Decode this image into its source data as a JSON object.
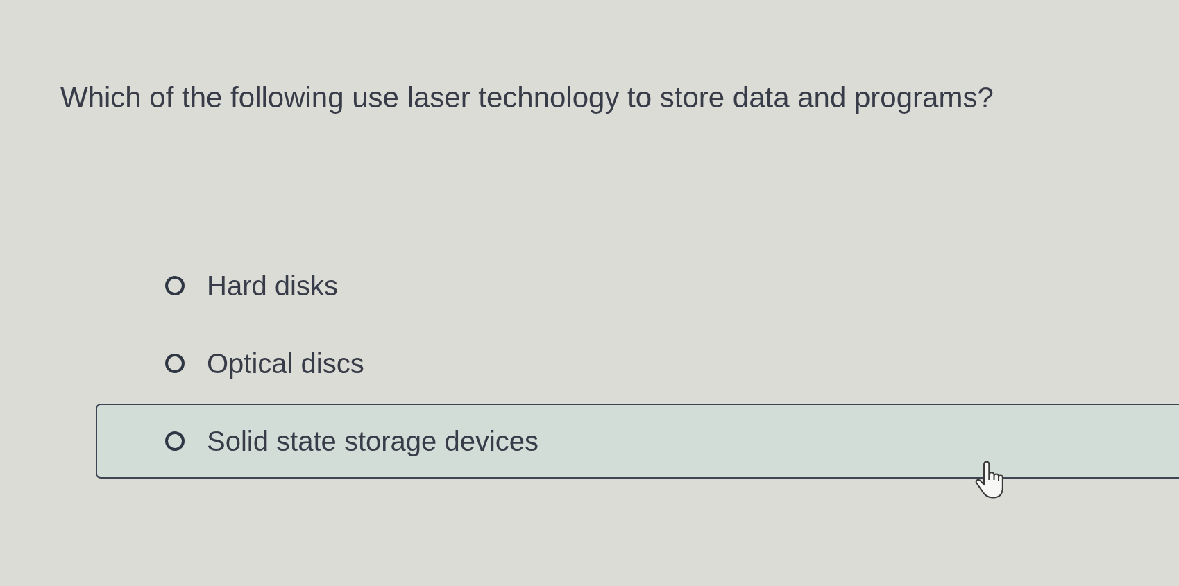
{
  "question": {
    "text": "Which of the following use laser technology to store data and programs?"
  },
  "options": [
    {
      "label": "Hard disks",
      "selected": false,
      "hovered": false
    },
    {
      "label": "Optical discs",
      "selected": false,
      "hovered": false
    },
    {
      "label": "Solid state storage devices",
      "selected": false,
      "hovered": true
    }
  ]
}
